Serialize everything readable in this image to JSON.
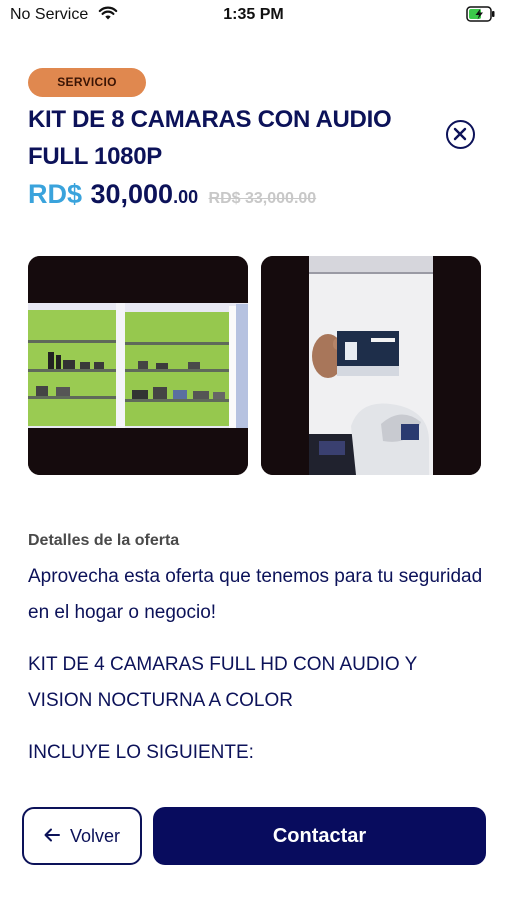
{
  "status_bar": {
    "carrier": "No Service",
    "time": "1:35 PM",
    "wifi_icon": "wifi-icon",
    "battery_icon": "battery-charging-icon"
  },
  "offer": {
    "badge": "SERVICIO",
    "title": "KIT DE 8 CAMARAS CON AUDIO FULL 1080P",
    "price": {
      "currency": "RD$",
      "amount": "30,000",
      "cents": ".00",
      "old_price": "RD$ 33,000.00"
    },
    "close_icon": "close-circle-icon",
    "images": [
      {
        "icon": "photo-store-shelves"
      },
      {
        "icon": "photo-hand-holding-dvr-box"
      }
    ]
  },
  "details": {
    "label": "Detalles de la oferta",
    "paragraphs": [
      "Aprovecha esta oferta que tenemos para tu seguridad en el hogar o negocio!",
      "KIT DE 4 CAMARAS FULL HD CON AUDIO Y VISION NOCTURNA A COLOR",
      "INCLUYE LO SIGUIENTE:"
    ]
  },
  "actions": {
    "back_label": "Volver",
    "back_icon": "arrow-left-icon",
    "contact_label": "Contactar"
  },
  "colors": {
    "primary": "#0c1259",
    "accent_blue": "#3aa3dc",
    "badge_orange": "#e0884f",
    "contact_bg": "#080c5e"
  }
}
